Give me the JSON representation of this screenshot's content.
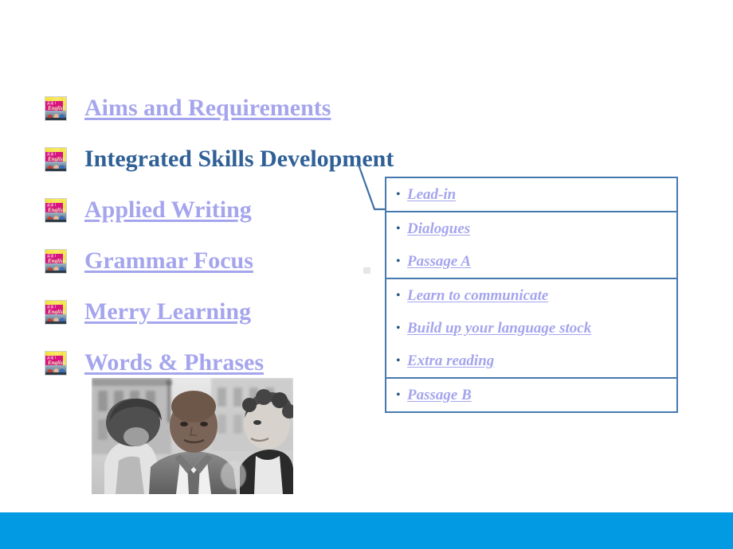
{
  "slide": {
    "background_color": "#ffffff",
    "link_color": "#a5a5ee",
    "current_color": "#2f6096",
    "border_color": "#4779ae",
    "bottom_bar_color": "#029ae3"
  },
  "nav": {
    "items": [
      {
        "label": "Aims and Requirements",
        "current": false,
        "icon": "english-textbook-icon"
      },
      {
        "label": "Integrated Skills Development",
        "current": true,
        "icon": "english-textbook-icon"
      },
      {
        "label": "Applied Writing",
        "current": false,
        "icon": "english-textbook-icon"
      },
      {
        "label": "Grammar Focus",
        "current": false,
        "icon": "english-textbook-icon"
      },
      {
        "label": "Merry Learning",
        "current": false,
        "icon": "english-textbook-icon"
      },
      {
        "label": "Words & Phrases",
        "current": false,
        "icon": "english-textbook-icon"
      }
    ]
  },
  "book_icon": {
    "title_cn": "英语 I",
    "script": "English"
  },
  "detail_box": {
    "cells": [
      {
        "items": [
          "Lead-in"
        ]
      },
      {
        "items": [
          "Dialogues",
          "Passage A"
        ]
      },
      {
        "items": [
          "Learn to communicate",
          "Build up your language stock",
          "Extra reading"
        ]
      },
      {
        "items": [
          "Passage B"
        ]
      }
    ],
    "bullet_glyph": "•"
  },
  "photo": {
    "alt": "three-men-talking-photo",
    "style": "black-and-white"
  }
}
